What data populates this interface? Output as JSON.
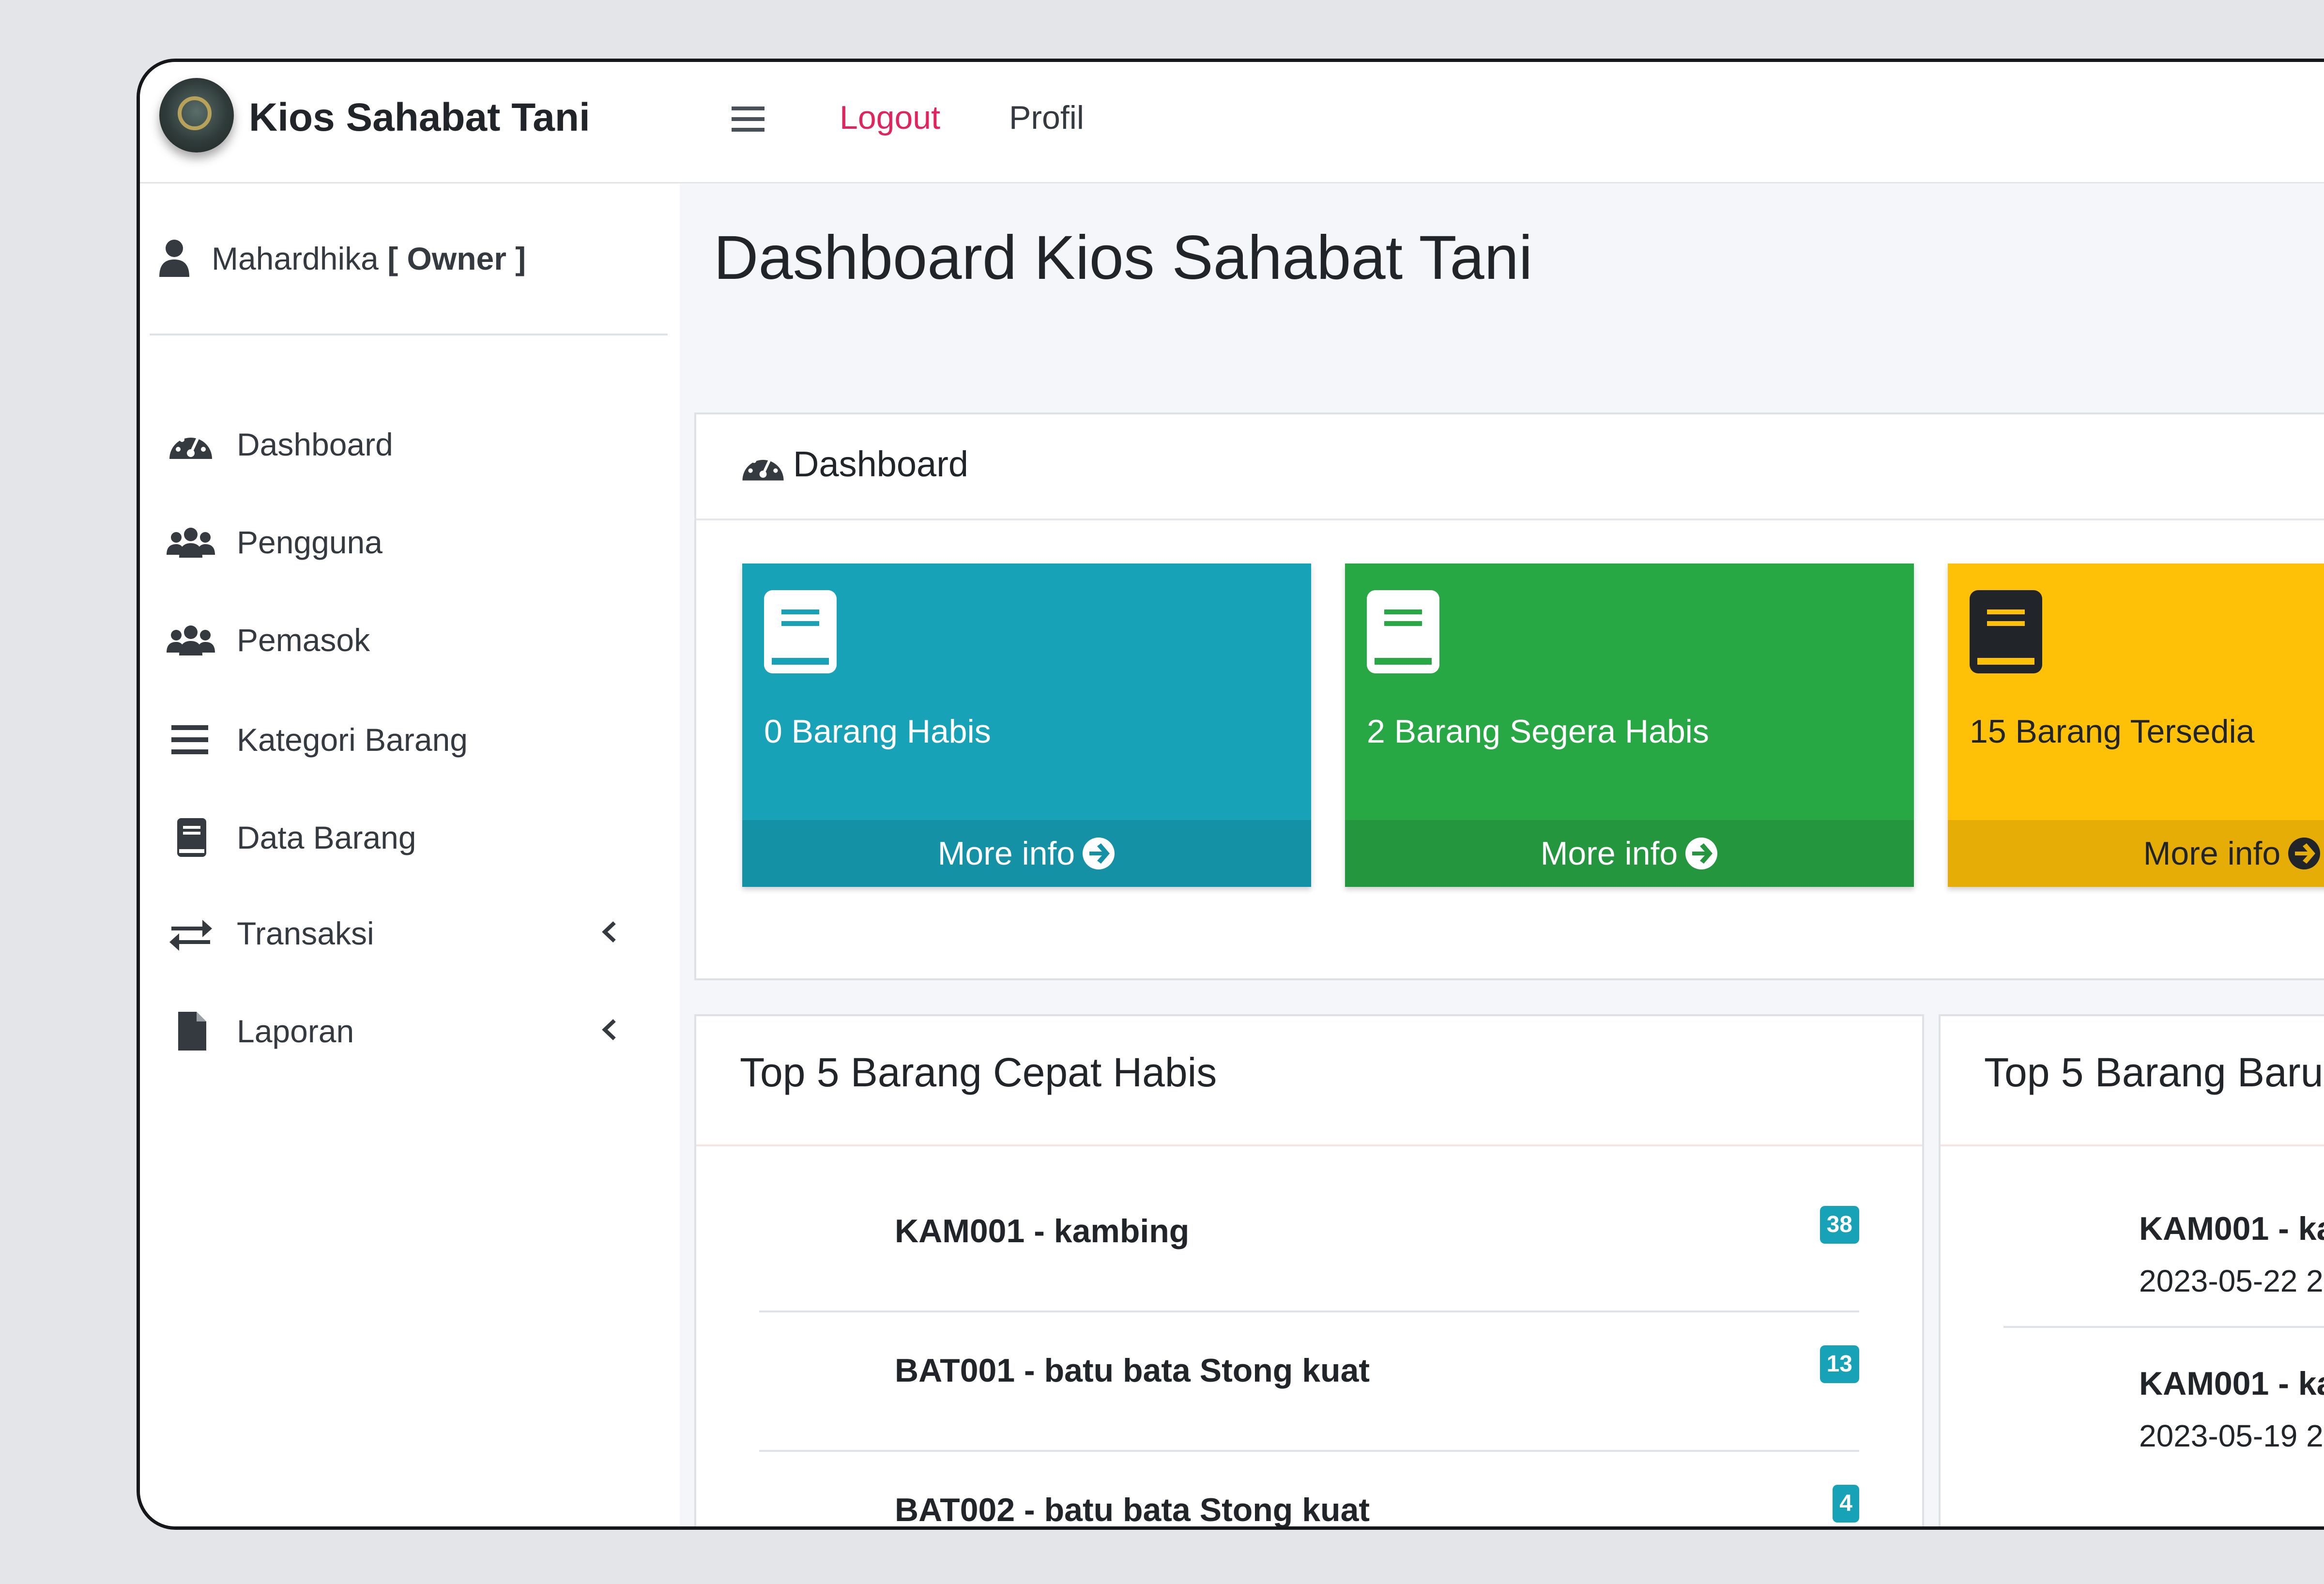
{
  "brand": {
    "title": "Kios Sahabat Tani"
  },
  "user": {
    "name": "Mahardhika",
    "role": "[ Owner ]"
  },
  "sidebar": {
    "items": [
      {
        "label": "Dashboard",
        "icon": "tachometer-icon"
      },
      {
        "label": "Pengguna",
        "icon": "users-icon"
      },
      {
        "label": "Pemasok",
        "icon": "users-icon"
      },
      {
        "label": "Kategori Barang",
        "icon": "list-icon"
      },
      {
        "label": "Data Barang",
        "icon": "book-icon"
      },
      {
        "label": "Transaksi",
        "icon": "exchange-icon",
        "has_children": true
      },
      {
        "label": "Laporan",
        "icon": "file-icon",
        "has_children": true
      }
    ]
  },
  "topbar": {
    "logout": "Logout",
    "profil": "Profil"
  },
  "page": {
    "title": "Dashboard Kios Sahabat Tani"
  },
  "dashboard_card": {
    "title": "Dashboard"
  },
  "info_boxes": [
    {
      "text": "0 Barang Habis",
      "more": "More info",
      "color": "#17a2b8"
    },
    {
      "text": "2 Barang Segera Habis",
      "more": "More info",
      "color": "#28a745"
    },
    {
      "text": "15 Barang Tersedia",
      "more": "More info",
      "color": "#ffc107"
    }
  ],
  "top_habis": {
    "title": "Top 5 Barang Cepat Habis",
    "rows": [
      {
        "name": "KAM001 - kambing",
        "badge": "38"
      },
      {
        "name": "BAT001 - batu bata Stong kuat",
        "badge": "13"
      },
      {
        "name": "BAT002 - batu bata Stong kuat",
        "badge": "4"
      }
    ]
  },
  "top_baru": {
    "title": "Top 5 Barang Baru",
    "rows": [
      {
        "name": "KAM001 - ka",
        "date": "2023-05-22 2"
      },
      {
        "name": "KAM001 - ka",
        "date": "2023-05-19 2"
      }
    ]
  }
}
